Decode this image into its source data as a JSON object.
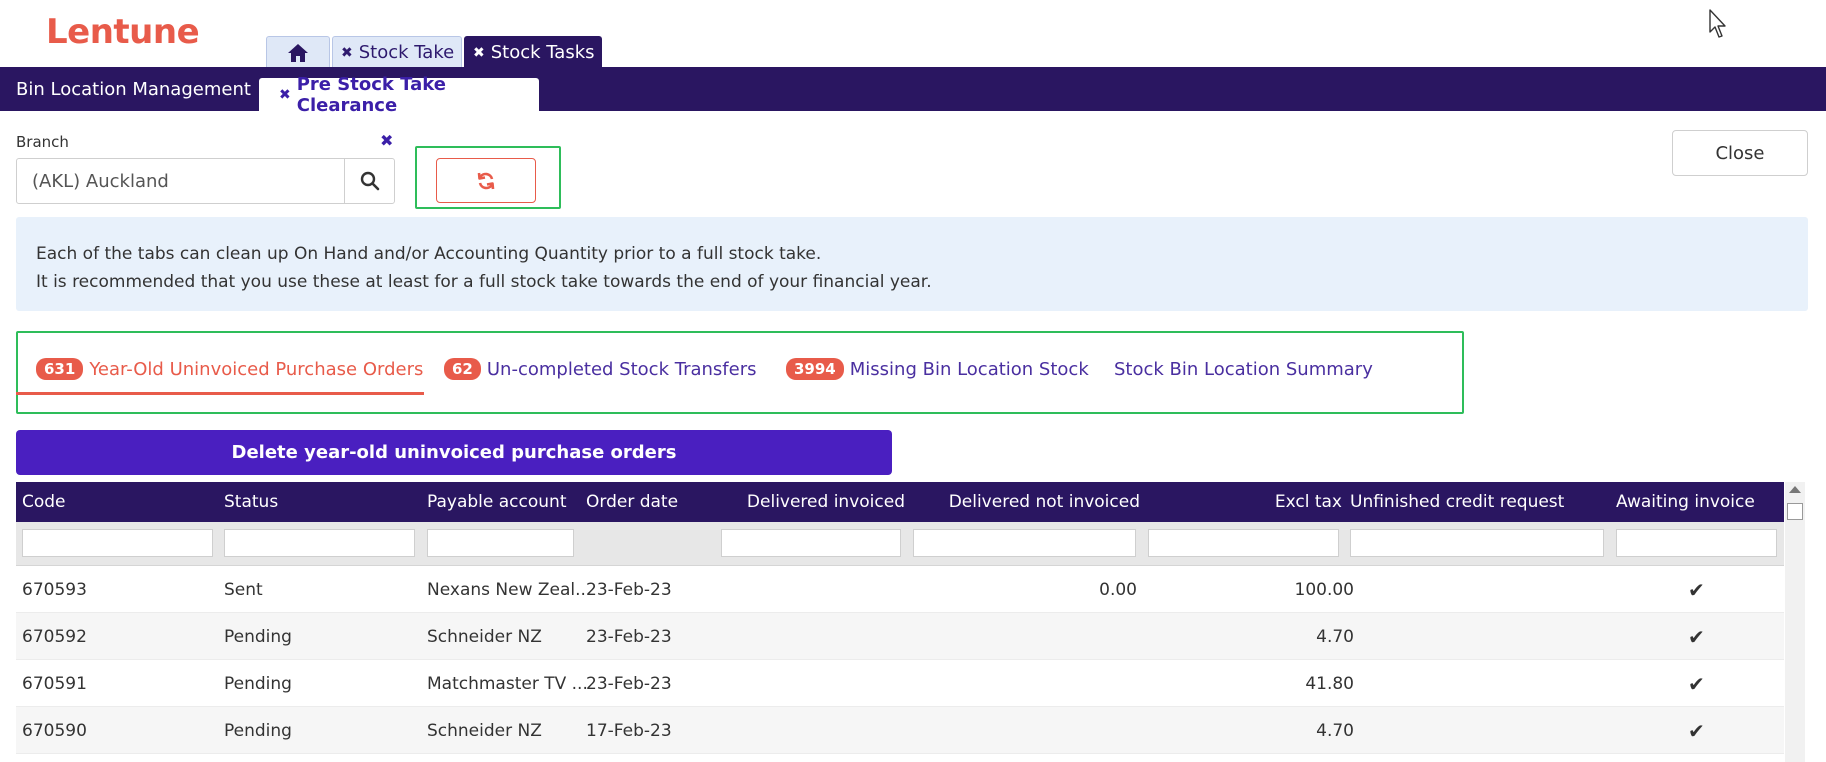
{
  "brand": {
    "logo": "Lentune"
  },
  "top_tabs": {
    "stock_take": "Stock Take",
    "stock_tasks": "Stock Tasks"
  },
  "sub_tabs": {
    "bin_location": "Bin Location Management",
    "pre_stock_take": "Pre Stock Take Clearance"
  },
  "branch": {
    "label": "Branch",
    "value": "(AKL) Auckland"
  },
  "close_label": "Close",
  "info": {
    "line1": "Each of the tabs can clean up On Hand and/or Accounting Quantity prior to a full stock take.",
    "line2": "It is recommended that you use these at least for a full stock take towards the end of your financial year."
  },
  "content_tabs": [
    {
      "badge": "631",
      "label": "Year-Old Uninvoiced Purchase Orders"
    },
    {
      "badge": "62",
      "label": "Un-completed Stock Transfers"
    },
    {
      "badge": "3994",
      "label": "Missing Bin Location Stock"
    },
    {
      "badge": "",
      "label": "Stock Bin Location Summary"
    }
  ],
  "delete_label": "Delete year-old uninvoiced purchase orders",
  "table": {
    "headers": [
      "Code",
      "Status",
      "Payable account",
      "Order date",
      "Delivered invoiced",
      "Delivered not invoiced",
      "Excl tax",
      "Unfinished credit request",
      "Awaiting invoice"
    ],
    "rows": [
      {
        "code": "670593",
        "status": "Sent",
        "account": "Nexans New Zeal...",
        "date": "23-Feb-23",
        "delivered_invoiced": "",
        "delivered_not_invoiced": "0.00",
        "excl_tax": "100.00",
        "credit": "",
        "awaiting": "✔"
      },
      {
        "code": "670592",
        "status": "Pending",
        "account": "Schneider NZ",
        "date": "23-Feb-23",
        "delivered_invoiced": "",
        "delivered_not_invoiced": "",
        "excl_tax": "4.70",
        "credit": "",
        "awaiting": "✔"
      },
      {
        "code": "670591",
        "status": "Pending",
        "account": "Matchmaster TV ...",
        "date": "23-Feb-23",
        "delivered_invoiced": "",
        "delivered_not_invoiced": "",
        "excl_tax": "41.80",
        "credit": "",
        "awaiting": "✔"
      },
      {
        "code": "670590",
        "status": "Pending",
        "account": "Schneider NZ",
        "date": "17-Feb-23",
        "delivered_invoiced": "",
        "delivered_not_invoiced": "",
        "excl_tax": "4.70",
        "credit": "",
        "awaiting": "✔"
      }
    ]
  },
  "colors": {
    "brand": "#e85b4a",
    "nav": "#2a1661",
    "accent": "#4a1fc0",
    "highlight": "#2ebd5a",
    "info_bg": "#e8f1fb"
  },
  "icons": {
    "home": "home-icon",
    "search": "search-icon",
    "refresh": "refresh-icon",
    "check": "check-icon",
    "close": "close-icon"
  }
}
